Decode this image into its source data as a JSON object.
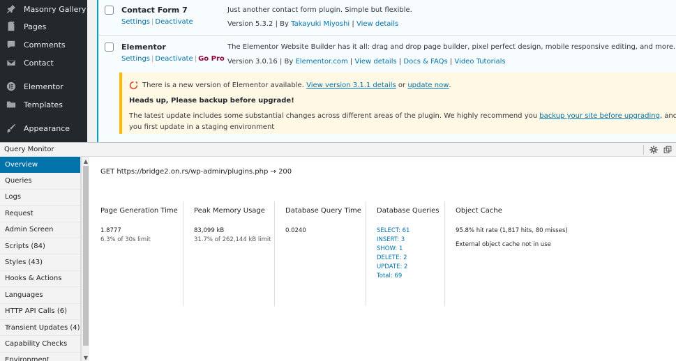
{
  "sidebar": {
    "items": [
      {
        "label": "Masonry Gallery",
        "icon": "pin-icon"
      },
      {
        "label": "Pages",
        "icon": "pages-icon"
      },
      {
        "label": "Comments",
        "icon": "comments-icon"
      },
      {
        "label": "Contact",
        "icon": "mail-icon"
      },
      {
        "label": "Elementor",
        "icon": "elementor-icon"
      },
      {
        "label": "Templates",
        "icon": "folder-icon"
      },
      {
        "label": "Appearance",
        "icon": "brush-icon"
      }
    ]
  },
  "plugins": [
    {
      "name": "Contact Form 7",
      "settings": "Settings",
      "deactivate": "Deactivate",
      "description": "Just another contact form plugin. Simple but flexible.",
      "version": "Version 5.3.2",
      "by": "By",
      "author": "Takayuki Miyoshi",
      "view_details": "View details"
    },
    {
      "name": "Elementor",
      "settings": "Settings",
      "deactivate": "Deactivate",
      "gopro": "Go Pro",
      "description": "The Elementor Website Builder has it all: drag and drop page builder, pixel perfect design, mobile responsive editing, and more. Get started now!",
      "version": "Version 3.0.16",
      "by": "By",
      "author": "Elementor.com",
      "view_details": "View details",
      "docs": "Docs & FAQs",
      "tutorials": "Video Tutorials"
    }
  ],
  "update_notice": {
    "line1_pre": "There is a new version of Elementor available.",
    "line1_link1": "View version 3.1.1 details",
    "line1_or": "or",
    "line1_link2": "update now",
    "line1_end": ".",
    "heading": "Heads up, Please backup before upgrade!",
    "line3_pre": "The latest update includes some substantial changes across different areas of the plugin. We highly recommend you",
    "line3_link": "backup your site before upgrading",
    "line3_post": ", and make sure",
    "line4": "you first update in a staging environment"
  },
  "qm": {
    "title": "Query Monitor",
    "nav": [
      "Overview",
      "Queries",
      "Logs",
      "Request",
      "Admin Screen",
      "Scripts (84)",
      "Styles (43)",
      "Hooks & Actions",
      "Languages",
      "HTTP API Calls (6)",
      "Transient Updates (4)",
      "Capability Checks",
      "Environment"
    ],
    "request_line": "GET https://bridge2.on.rs/wp-admin/plugins.php → 200",
    "columns": {
      "page_gen": {
        "head": "Page Generation Time",
        "value": "1.8777",
        "sub": "6.3% of 30s limit"
      },
      "peak_mem": {
        "head": "Peak Memory Usage",
        "value": "83,099 kB",
        "sub": "31.7% of 262,144 kB limit"
      },
      "db_time": {
        "head": "Database Query Time",
        "value": "0.0240"
      },
      "db_queries": {
        "head": "Database Queries",
        "items": [
          "SELECT: 61",
          "INSERT: 3",
          "SHOW: 1",
          "DELETE: 2",
          "UPDATE: 2",
          "Total: 69"
        ]
      },
      "object_cache": {
        "head": "Object Cache",
        "value": "95.8% hit rate (1,817 hits, 80 misses)",
        "note": "External object cache not in use"
      }
    }
  },
  "colors": {
    "sidebar_bg": "#23282d",
    "accent": "#0073aa",
    "notice_border": "#ffb900",
    "notice_bg": "#fff8e5",
    "gopro": "#93003c"
  }
}
